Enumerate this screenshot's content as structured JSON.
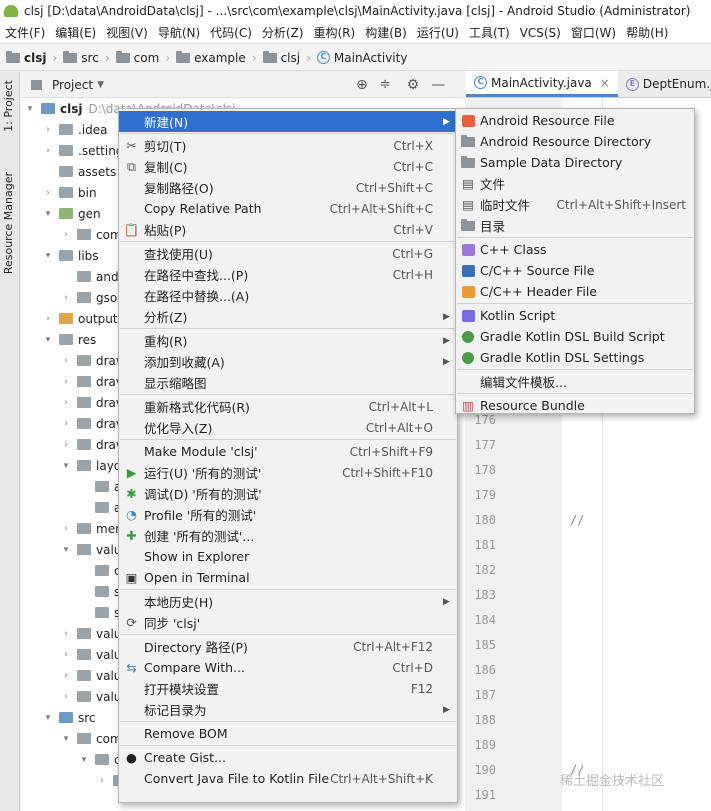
{
  "window_title": "clsj [D:\\data\\AndroidData\\clsj] - ...\\src\\com\\example\\clsj\\MainActivity.java [clsj] - Android Studio (Administrator)",
  "menubar": [
    "文件(F)",
    "编辑(E)",
    "视图(V)",
    "导航(N)",
    "代码(C)",
    "分析(Z)",
    "重构(R)",
    "构建(B)",
    "运行(U)",
    "工具(T)",
    "VCS(S)",
    "窗口(W)",
    "帮助(H)"
  ],
  "breadcrumb": [
    "clsj",
    "src",
    "com",
    "example",
    "clsj",
    "MainActivity"
  ],
  "left_strip": {
    "project_tab": "1: Project",
    "resource_tab": "Resource Manager"
  },
  "project_panel": {
    "title": "Project"
  },
  "tree": [
    {
      "label": "clsj",
      "suffix": "D:\\data\\AndroidData\\clsj"
    },
    {
      "label": ".idea"
    },
    {
      "label": ".setting"
    },
    {
      "label": "assets"
    },
    {
      "label": "bin"
    },
    {
      "label": "gen"
    },
    {
      "label": "com"
    },
    {
      "label": "libs"
    },
    {
      "label": "and"
    },
    {
      "label": "gso"
    },
    {
      "label": "output"
    },
    {
      "label": "res"
    },
    {
      "label": "drav"
    },
    {
      "label": "drav"
    },
    {
      "label": "drav"
    },
    {
      "label": "drav"
    },
    {
      "label": "drav"
    },
    {
      "label": "layo"
    },
    {
      "label": "a"
    },
    {
      "label": "a"
    },
    {
      "label": "mer"
    },
    {
      "label": "valu"
    },
    {
      "label": "c"
    },
    {
      "label": "s"
    },
    {
      "label": "s"
    },
    {
      "label": "valu"
    },
    {
      "label": "valu"
    },
    {
      "label": "valu"
    },
    {
      "label": "valu"
    },
    {
      "label": "src"
    },
    {
      "label": "com"
    },
    {
      "label": "c"
    },
    {
      "label": "entity"
    }
  ],
  "editor_tabs": [
    {
      "label": "MainActivity.java"
    },
    {
      "label": "DeptEnum.ja"
    }
  ],
  "line_numbers": [
    "176",
    "177",
    "178",
    "179",
    "180",
    "181",
    "182",
    "183",
    "184",
    "185",
    "186",
    "187",
    "188",
    "189",
    "190",
    "191"
  ],
  "code_fragments": {
    "l1": "如",
    "l2": "in",
    "l3": "//",
    "l4": "if",
    "l180": "//",
    "l190": "//"
  },
  "context_menu": [
    {
      "label": "新建(N)",
      "shortcut": "",
      "submenu": true,
      "icon": "",
      "selected": true
    },
    {
      "label": "剪切(T)",
      "shortcut": "Ctrl+X",
      "icon": "scissors-icon"
    },
    {
      "label": "复制(C)",
      "shortcut": "Ctrl+C",
      "icon": "copy-icon"
    },
    {
      "label": "复制路径(O)",
      "shortcut": "Ctrl+Shift+C"
    },
    {
      "label": "Copy Relative Path",
      "shortcut": "Ctrl+Alt+Shift+C"
    },
    {
      "label": "粘贴(P)",
      "shortcut": "Ctrl+V",
      "icon": "paste-icon"
    },
    {
      "label": "查找使用(U)",
      "shortcut": "Ctrl+G"
    },
    {
      "label": "在路径中查找...(P)",
      "shortcut": "Ctrl+H"
    },
    {
      "label": "在路径中替换...(A)",
      "shortcut": ""
    },
    {
      "label": "分析(Z)",
      "shortcut": "",
      "submenu": true
    },
    {
      "label": "重构(R)",
      "shortcut": "",
      "submenu": true
    },
    {
      "label": "添加到收藏(A)",
      "shortcut": "",
      "submenu": true
    },
    {
      "label": "显示缩略图",
      "shortcut": ""
    },
    {
      "label": "重新格式化代码(R)",
      "shortcut": "Ctrl+Alt+L"
    },
    {
      "label": "优化导入(Z)",
      "shortcut": "Ctrl+Alt+O"
    },
    {
      "label": "Make Module 'clsj'",
      "shortcut": "Ctrl+Shift+F9"
    },
    {
      "label": "运行(U) '所有的测试'",
      "shortcut": "Ctrl+Shift+F10",
      "icon": "run-icon"
    },
    {
      "label": "调试(D) '所有的测试'",
      "shortcut": "",
      "icon": "debug-icon"
    },
    {
      "label": "Profile '所有的测试'",
      "shortcut": "",
      "icon": "profile-icon"
    },
    {
      "label": "创建 '所有的测试'...",
      "shortcut": "",
      "icon": "create-test-icon"
    },
    {
      "label": "Show in Explorer",
      "shortcut": ""
    },
    {
      "label": "Open in Terminal",
      "shortcut": "",
      "icon": "terminal-icon"
    },
    {
      "label": "本地历史(H)",
      "shortcut": "",
      "submenu": true
    },
    {
      "label": "同步 'clsj'",
      "shortcut": "",
      "icon": "sync-icon"
    },
    {
      "label": "Directory 路径(P)",
      "shortcut": "Ctrl+Alt+F12"
    },
    {
      "label": "Compare With...",
      "shortcut": "Ctrl+D",
      "icon": "compare-icon"
    },
    {
      "label": "打开模块设置",
      "shortcut": "F12"
    },
    {
      "label": "标记目录为",
      "shortcut": "",
      "submenu": true
    },
    {
      "label": "Remove BOM",
      "shortcut": ""
    },
    {
      "label": "Create Gist...",
      "shortcut": "",
      "icon": "github-icon"
    },
    {
      "label": "Convert Java File to Kotlin File",
      "shortcut": "Ctrl+Alt+Shift+K"
    }
  ],
  "new_submenu": [
    {
      "label": "Android Resource File",
      "shortcut": ""
    },
    {
      "label": "Android Resource Directory",
      "shortcut": ""
    },
    {
      "label": "Sample Data Directory",
      "shortcut": ""
    },
    {
      "label": "文件",
      "shortcut": ""
    },
    {
      "label": "临时文件",
      "shortcut": "Ctrl+Alt+Shift+Insert"
    },
    {
      "label": "目录",
      "shortcut": ""
    },
    {
      "label": "C++ Class",
      "shortcut": ""
    },
    {
      "label": "C/C++ Source File",
      "shortcut": ""
    },
    {
      "label": "C/C++ Header File",
      "shortcut": ""
    },
    {
      "label": "Kotlin Script",
      "shortcut": ""
    },
    {
      "label": "Gradle Kotlin DSL Build Script",
      "shortcut": ""
    },
    {
      "label": "Gradle Kotlin DSL Settings",
      "shortcut": ""
    },
    {
      "label": "编辑文件模板...",
      "shortcut": ""
    },
    {
      "label": "Resource Bundle",
      "shortcut": ""
    }
  ],
  "watermark": "稀土掘金技术社区",
  "colors": {
    "selection": "#2e6fcf",
    "tab_underline": "#4a86c8"
  }
}
